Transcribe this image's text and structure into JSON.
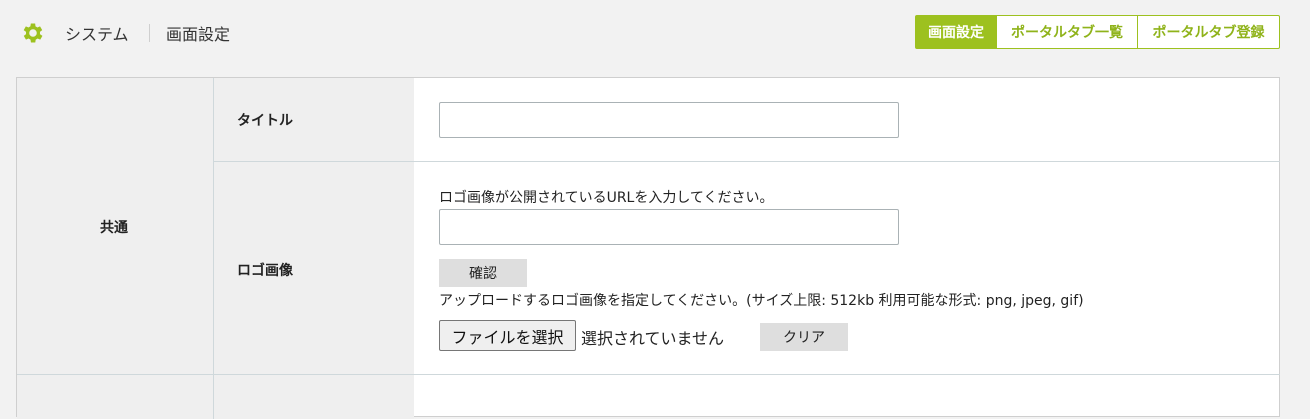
{
  "header": {
    "section": "システム",
    "page": "画面設定",
    "icon": "gear-icon",
    "accent_color": "#9dc11f"
  },
  "tabs": [
    {
      "label": "画面設定",
      "active": true
    },
    {
      "label": "ポータルタブ一覧",
      "active": false
    },
    {
      "label": "ポータルタブ登録",
      "active": false
    }
  ],
  "form": {
    "category": "共通",
    "title_field": {
      "label": "タイトル",
      "value": ""
    },
    "logo_field": {
      "label": "ロゴ画像",
      "url_hint": "ロゴ画像が公開されているURLを入力してください。",
      "url_value": "",
      "confirm_label": "確認",
      "upload_hint": "アップロードするロゴ画像を指定してください。(サイズ上限: 512kb 利用可能な形式: png, jpeg, gif)",
      "file_button_label": "ファイルを選択",
      "file_status": "選択されていません",
      "clear_label": "クリア"
    }
  }
}
